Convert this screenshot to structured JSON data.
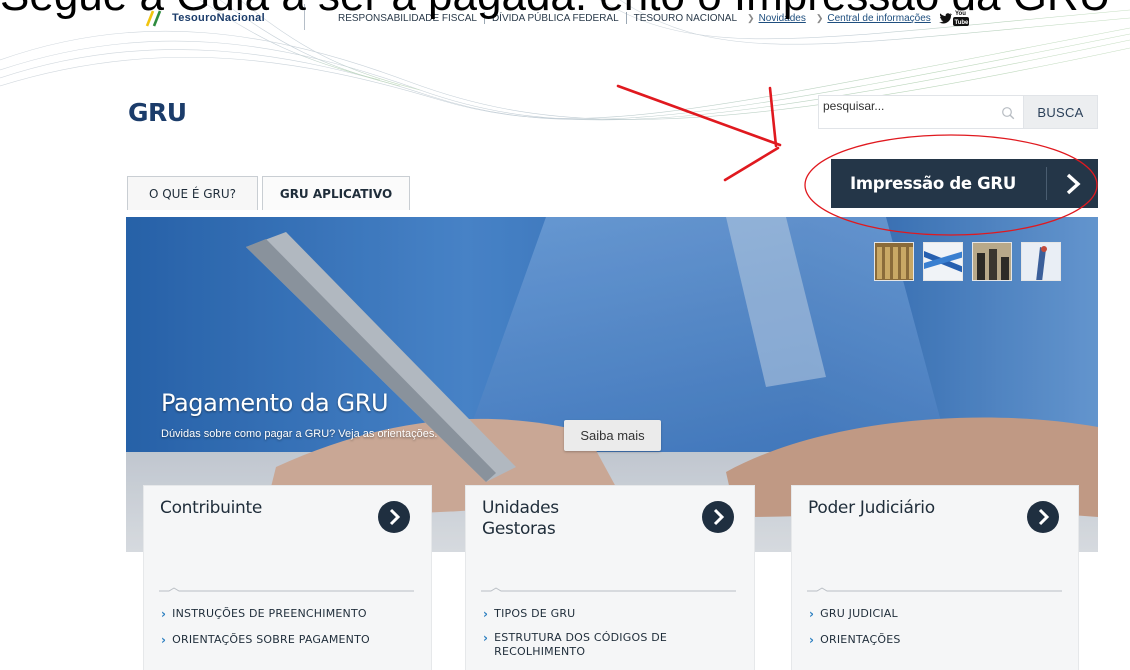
{
  "overlay_caption": "Segue a Guia a ser a pagada. ento o Impressao da GRU",
  "topbar": {
    "logo_text": "TesouroNacional",
    "links": [
      "RESPONSABILIDADE FISCAL",
      "DÍVIDA PÚBLICA FEDERAL",
      "TESOURO NACIONAL"
    ],
    "underlined_links": [
      "Novidades",
      "Central de informações"
    ],
    "social_icons": [
      "twitter-icon",
      "youtube-icon"
    ]
  },
  "page_title": "GRU",
  "search": {
    "placeholder": "pesquisar...",
    "button_label": "BUSCA"
  },
  "print_button": {
    "label": "Impressão de GRU"
  },
  "tabs": [
    {
      "label": "O QUE É GRU?"
    },
    {
      "label": "GRU APLICATIVO"
    }
  ],
  "hero": {
    "title": "Pagamento da GRU",
    "subtitle": "Dúvidas sobre como pagar a GRU? Veja as orientações.",
    "button_label": "Saiba mais",
    "thumbnails": [
      "books-thumbnail",
      "flag-thumbnail",
      "building-thumbnail",
      "figure-thumbnail"
    ]
  },
  "cards": [
    {
      "title_lines": [
        "Contribuinte"
      ],
      "links": [
        "INSTRUÇÕES DE PREENCHIMENTO",
        "ORIENTAÇÕES SOBRE PAGAMENTO"
      ]
    },
    {
      "title_lines": [
        "Unidades",
        "Gestoras"
      ],
      "links": [
        "TIPOS DE GRU",
        "ESTRUTURA DOS CÓDIGOS DE RECOLHIMENTO"
      ]
    },
    {
      "title_lines": [
        "Poder Judiciário"
      ],
      "links": [
        "GRU JUDICIAL",
        "ORIENTAÇÕES"
      ]
    }
  ],
  "colors": {
    "brand_dark": "#243648",
    "title_blue": "#1b3c6a",
    "annotation_red": "#e0191f",
    "bullet_blue": "#2c7fc0"
  }
}
